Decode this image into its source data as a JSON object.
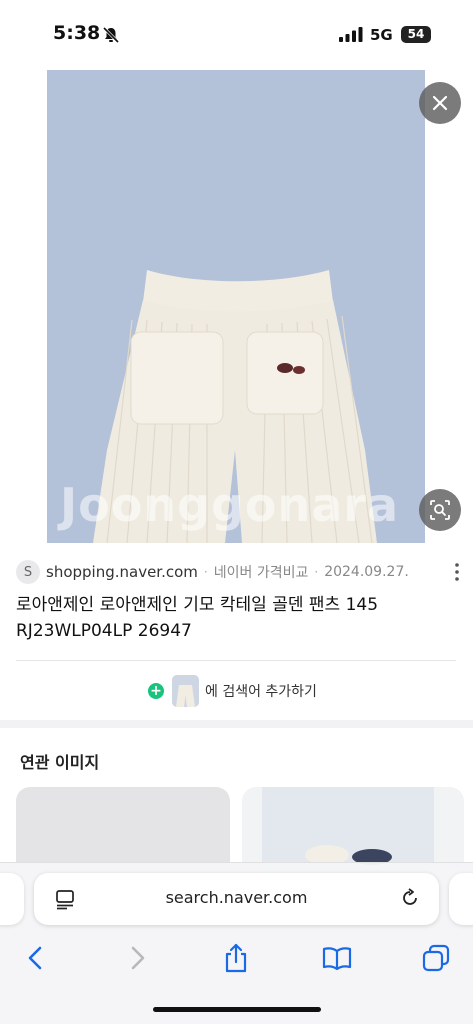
{
  "status_bar": {
    "time": "5:38",
    "network": "5G",
    "battery": "54",
    "icons": [
      "bell-off-icon",
      "signal-icon"
    ]
  },
  "viewer": {
    "watermark": "Joonggonara",
    "image_alt": "cream ribbed pants with two front pockets on light blue background",
    "embroidery": "R&J",
    "colors": {
      "background": "#b3c1d9",
      "garment": "#f2ede2"
    },
    "icons": [
      "close-icon",
      "lens-search-icon"
    ]
  },
  "result": {
    "favicon_letter": "S",
    "domain": "shopping.naver.com",
    "separator": "·",
    "site": "네이버 가격비교",
    "date": "2024.09.27.",
    "title": "로아앤제인 로아앤제인 기모 칵테일 골덴 팬츠 145 RJ23WLP04LP 26947",
    "add_to_search": "에 검색어 추가하기",
    "add_icon_color": "#19c37d"
  },
  "related": {
    "title": "연관 이미지"
  },
  "browser": {
    "url": "search.naver.com",
    "icons": [
      "reader-icon",
      "reload-icon",
      "back-icon",
      "forward-icon",
      "share-icon",
      "bookmarks-icon",
      "tabs-icon"
    ],
    "accent": "#1a6ae6"
  }
}
